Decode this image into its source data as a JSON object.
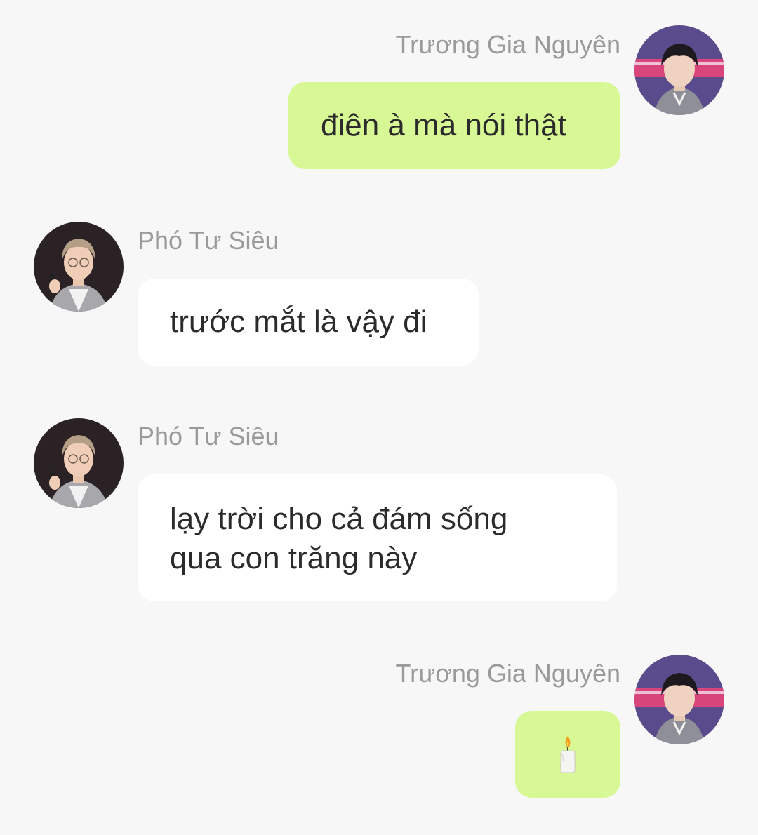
{
  "chat": {
    "messages": [
      {
        "sender": "Trương Gia Nguyên",
        "text": "điên à mà nói thật",
        "side": "right"
      },
      {
        "sender": "Phó Tư Siêu",
        "text": "trước mắt là vậy đi",
        "side": "left"
      },
      {
        "sender": "Phó Tư Siêu",
        "lines": [
          "lạy trời cho cả đám sống",
          "qua con trăng này"
        ],
        "side": "left"
      },
      {
        "sender": "Trương Gia Nguyên",
        "icon": "candle-emoji",
        "side": "right"
      }
    ]
  },
  "colors": {
    "background": "#f7f7f7",
    "outgoing_bubble": "#d8f896",
    "incoming_bubble": "#ffffff",
    "sender_name": "#9a9a9a",
    "message_text": "#2b2b2b"
  }
}
